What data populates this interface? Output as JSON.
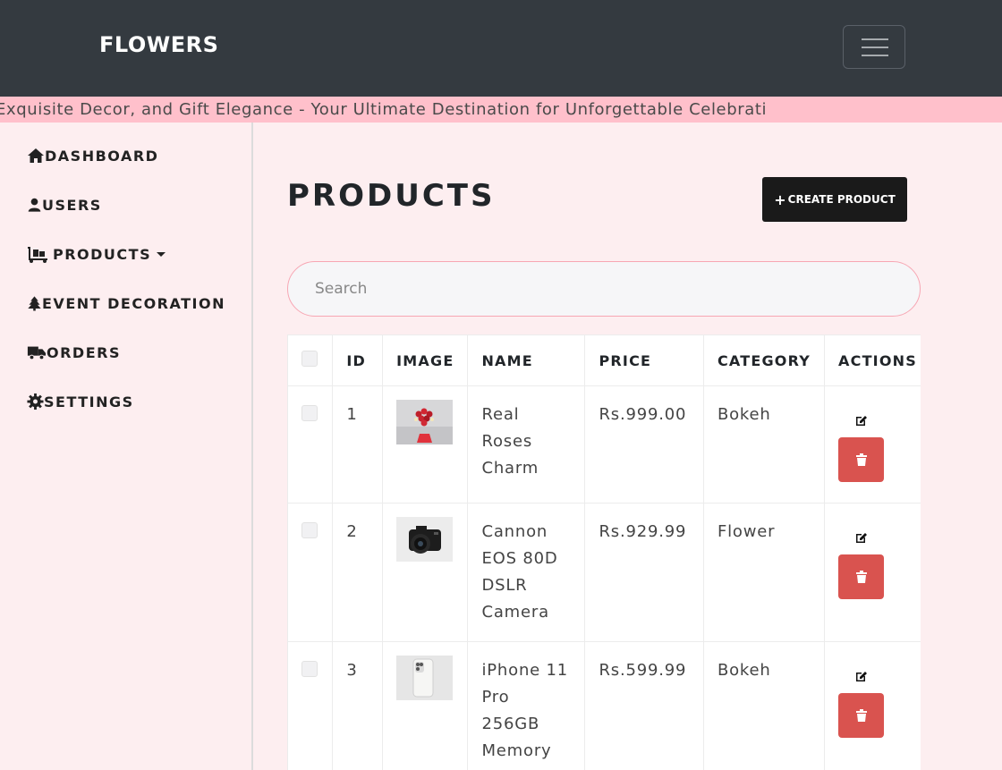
{
  "header": {
    "brand": "FLOWERS",
    "menu_toggle_icon": "hamburger-icon"
  },
  "marquee": {
    "text": "Exquisite Decor, and Gift Elegance - Your Ultimate Destination for Unforgettable Celebrati"
  },
  "sidebar": {
    "items": [
      {
        "label": "DASHBOARD",
        "icon": "home-icon"
      },
      {
        "label": "USERS",
        "icon": "user-icon"
      },
      {
        "label": "PRODUCTS",
        "icon": "dolly-icon"
      },
      {
        "label": "EVENT DECORATION",
        "icon": "tree-icon"
      },
      {
        "label": "ORDERS",
        "icon": "truck-icon"
      },
      {
        "label": "SETTINGS",
        "icon": "gear-icon"
      }
    ]
  },
  "main": {
    "title": "PRODUCTS",
    "create_button": "CREATE PRODUCT",
    "search_placeholder": "Search"
  },
  "table": {
    "columns": [
      "ID",
      "IMAGE",
      "NAME",
      "PRICE",
      "CATEGORY",
      "ACTIONS"
    ],
    "rows": [
      {
        "id": "1",
        "name": [
          "Real",
          "Roses",
          "Charm"
        ],
        "price": "Rs.999.00",
        "category": "Bokeh"
      },
      {
        "id": "2",
        "name": [
          "Cannon",
          "EOS 80D",
          "DSLR",
          "Camera"
        ],
        "price": "Rs.929.99",
        "category": "Flower"
      },
      {
        "id": "3",
        "name": [
          "iPhone 11",
          "Pro",
          "256GB",
          "Memory"
        ],
        "price": "Rs.599.99",
        "category": "Bokeh"
      }
    ]
  },
  "colors": {
    "topbar": "#343a40",
    "marquee": "#ffc0cb",
    "background": "#fdeef0",
    "delete": "#d9534f",
    "create": "#1a1a1a"
  }
}
